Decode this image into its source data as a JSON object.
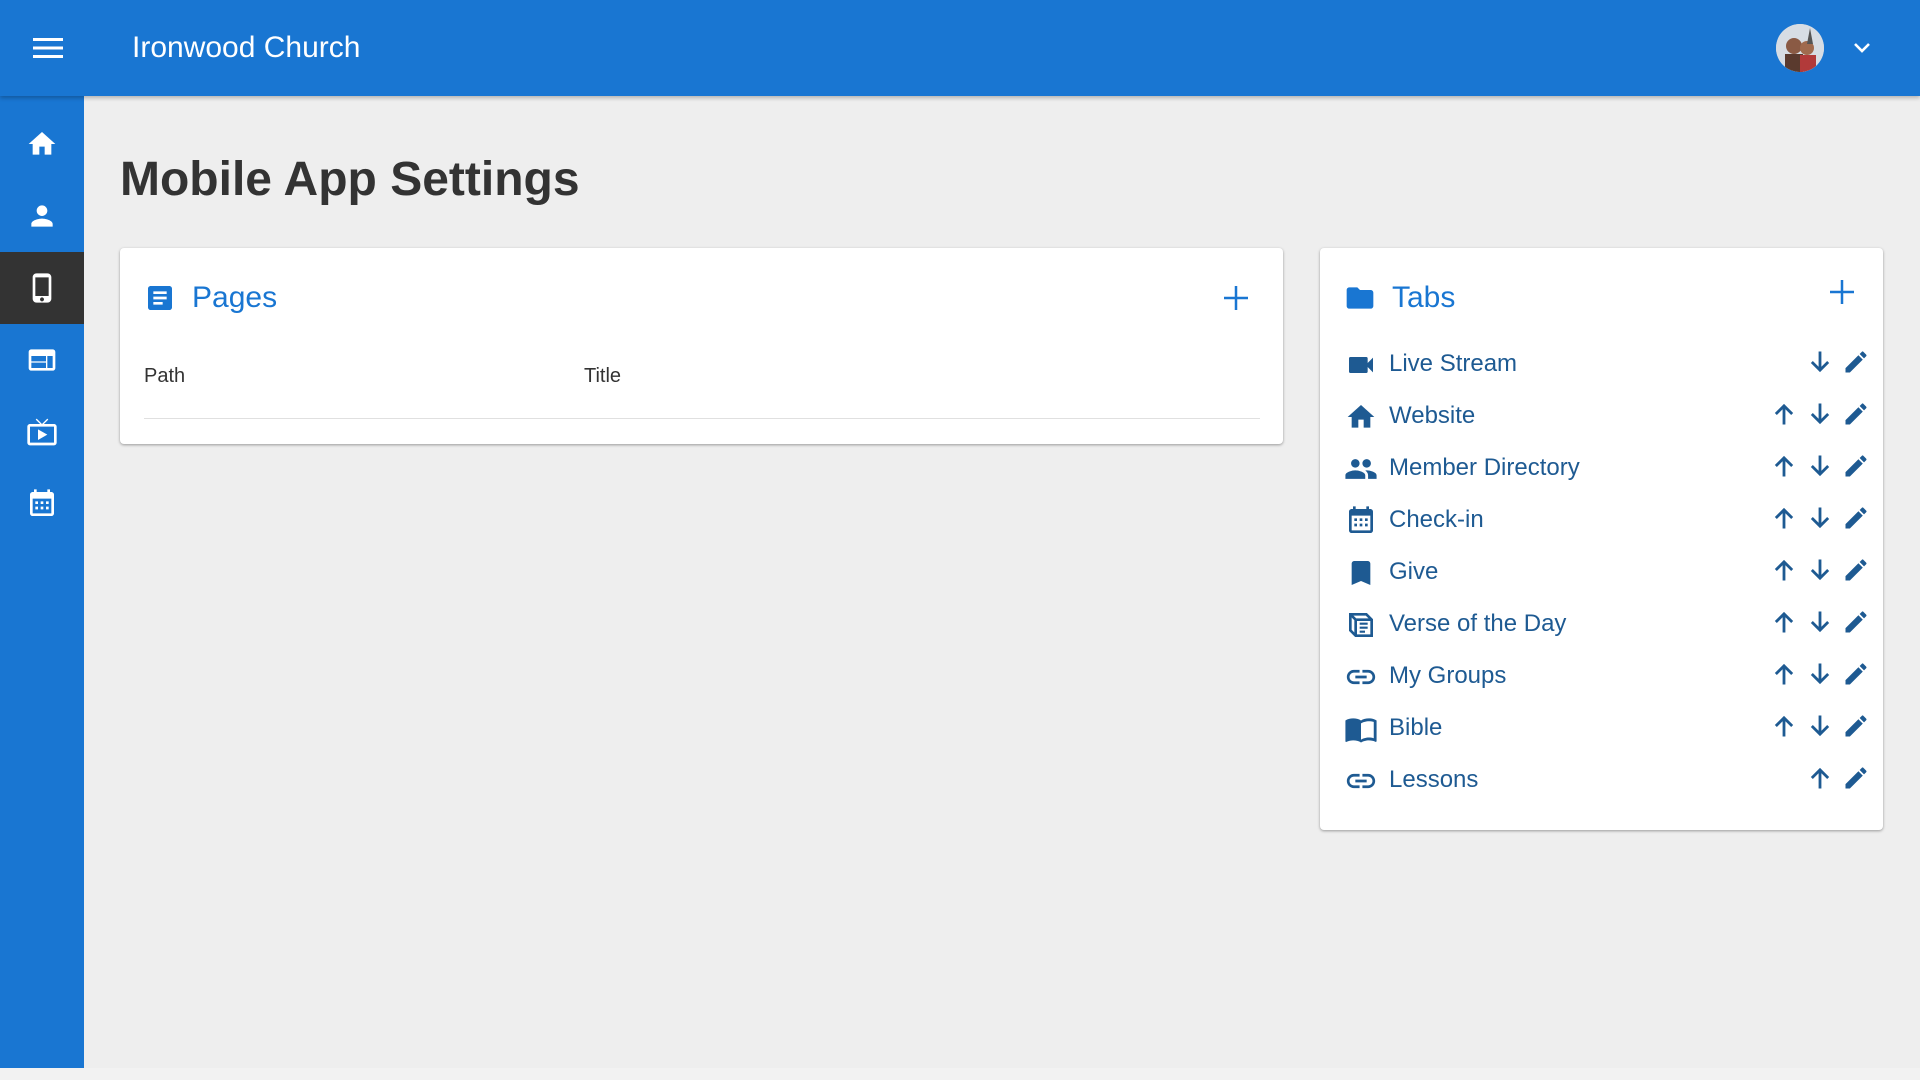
{
  "topbar": {
    "menu_icon": "menu-icon",
    "title": "Ironwood Church",
    "avatar_icon": "user-avatar",
    "chevron_icon": "chevron-down-icon",
    "color": "#1976d2"
  },
  "sidebar": {
    "items": [
      {
        "name": "home",
        "icon": "home-icon",
        "active": false
      },
      {
        "name": "people",
        "icon": "person-icon",
        "active": false
      },
      {
        "name": "mobile",
        "icon": "smartphone-icon",
        "active": true
      },
      {
        "name": "website",
        "icon": "web-icon",
        "active": false
      },
      {
        "name": "sermons",
        "icon": "live-tv-icon",
        "active": false
      },
      {
        "name": "calendar",
        "icon": "calendar-icon",
        "active": false
      }
    ]
  },
  "main": {
    "page_title": "Mobile App Settings"
  },
  "pages_card": {
    "title": "Pages",
    "icon": "article-icon",
    "add_icon": "add-icon",
    "columns": [
      "Path",
      "Title"
    ],
    "rows": []
  },
  "tabs_card": {
    "title": "Tabs",
    "icon": "folder-icon",
    "add_icon": "add-icon",
    "tabs": [
      {
        "label": "Live Stream",
        "icon": "videocam-icon",
        "up": false,
        "down": true
      },
      {
        "label": "Website",
        "icon": "home-icon",
        "up": true,
        "down": true
      },
      {
        "label": "Member Directory",
        "icon": "people-icon",
        "up": true,
        "down": true
      },
      {
        "label": "Check-in",
        "icon": "calendar-icon",
        "up": true,
        "down": true
      },
      {
        "label": "Give",
        "icon": "bookmark-icon",
        "up": true,
        "down": true
      },
      {
        "label": "Verse of the Day",
        "icon": "verse-icon",
        "up": true,
        "down": true
      },
      {
        "label": "My Groups",
        "icon": "link-icon",
        "up": true,
        "down": true
      },
      {
        "label": "Bible",
        "icon": "menu-book-icon",
        "up": true,
        "down": true
      },
      {
        "label": "Lessons",
        "icon": "link-icon",
        "up": true,
        "down": false
      }
    ]
  },
  "colors": {
    "primary": "#1976d2",
    "tab_text": "#1e5a92",
    "active_nav": "#333333",
    "background": "#eeeeee"
  }
}
